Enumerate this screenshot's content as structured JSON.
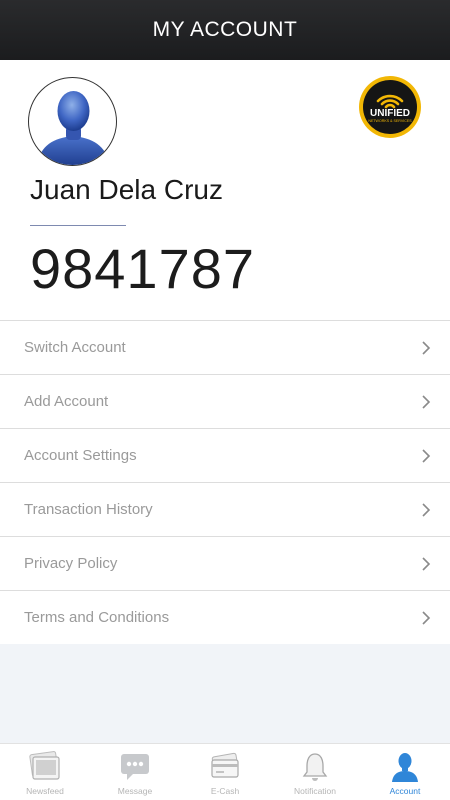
{
  "header": {
    "title": "MY ACCOUNT"
  },
  "profile": {
    "name": "Juan Dela Cruz",
    "account_number": "9841787",
    "brand_logo_text": "UNIFIED",
    "brand_logo_subtext": "NETWORKS & SERVICES"
  },
  "menu": {
    "items": [
      {
        "label": "Switch Account"
      },
      {
        "label": "Add Account"
      },
      {
        "label": "Account Settings"
      },
      {
        "label": "Transaction History"
      },
      {
        "label": "Privacy Policy"
      },
      {
        "label": "Terms and Conditions"
      }
    ]
  },
  "bottom_nav": {
    "items": [
      {
        "label": "Newsfeed",
        "icon": "newsfeed-icon"
      },
      {
        "label": "Message",
        "icon": "message-icon"
      },
      {
        "label": "E-Cash",
        "icon": "ecash-icon"
      },
      {
        "label": "Notification",
        "icon": "bell-icon"
      },
      {
        "label": "Account",
        "icon": "account-icon",
        "active": true
      }
    ]
  },
  "colors": {
    "header_bg": "#1f2022",
    "active_tab": "#2f86d8",
    "logo_gold": "#f2b705"
  }
}
